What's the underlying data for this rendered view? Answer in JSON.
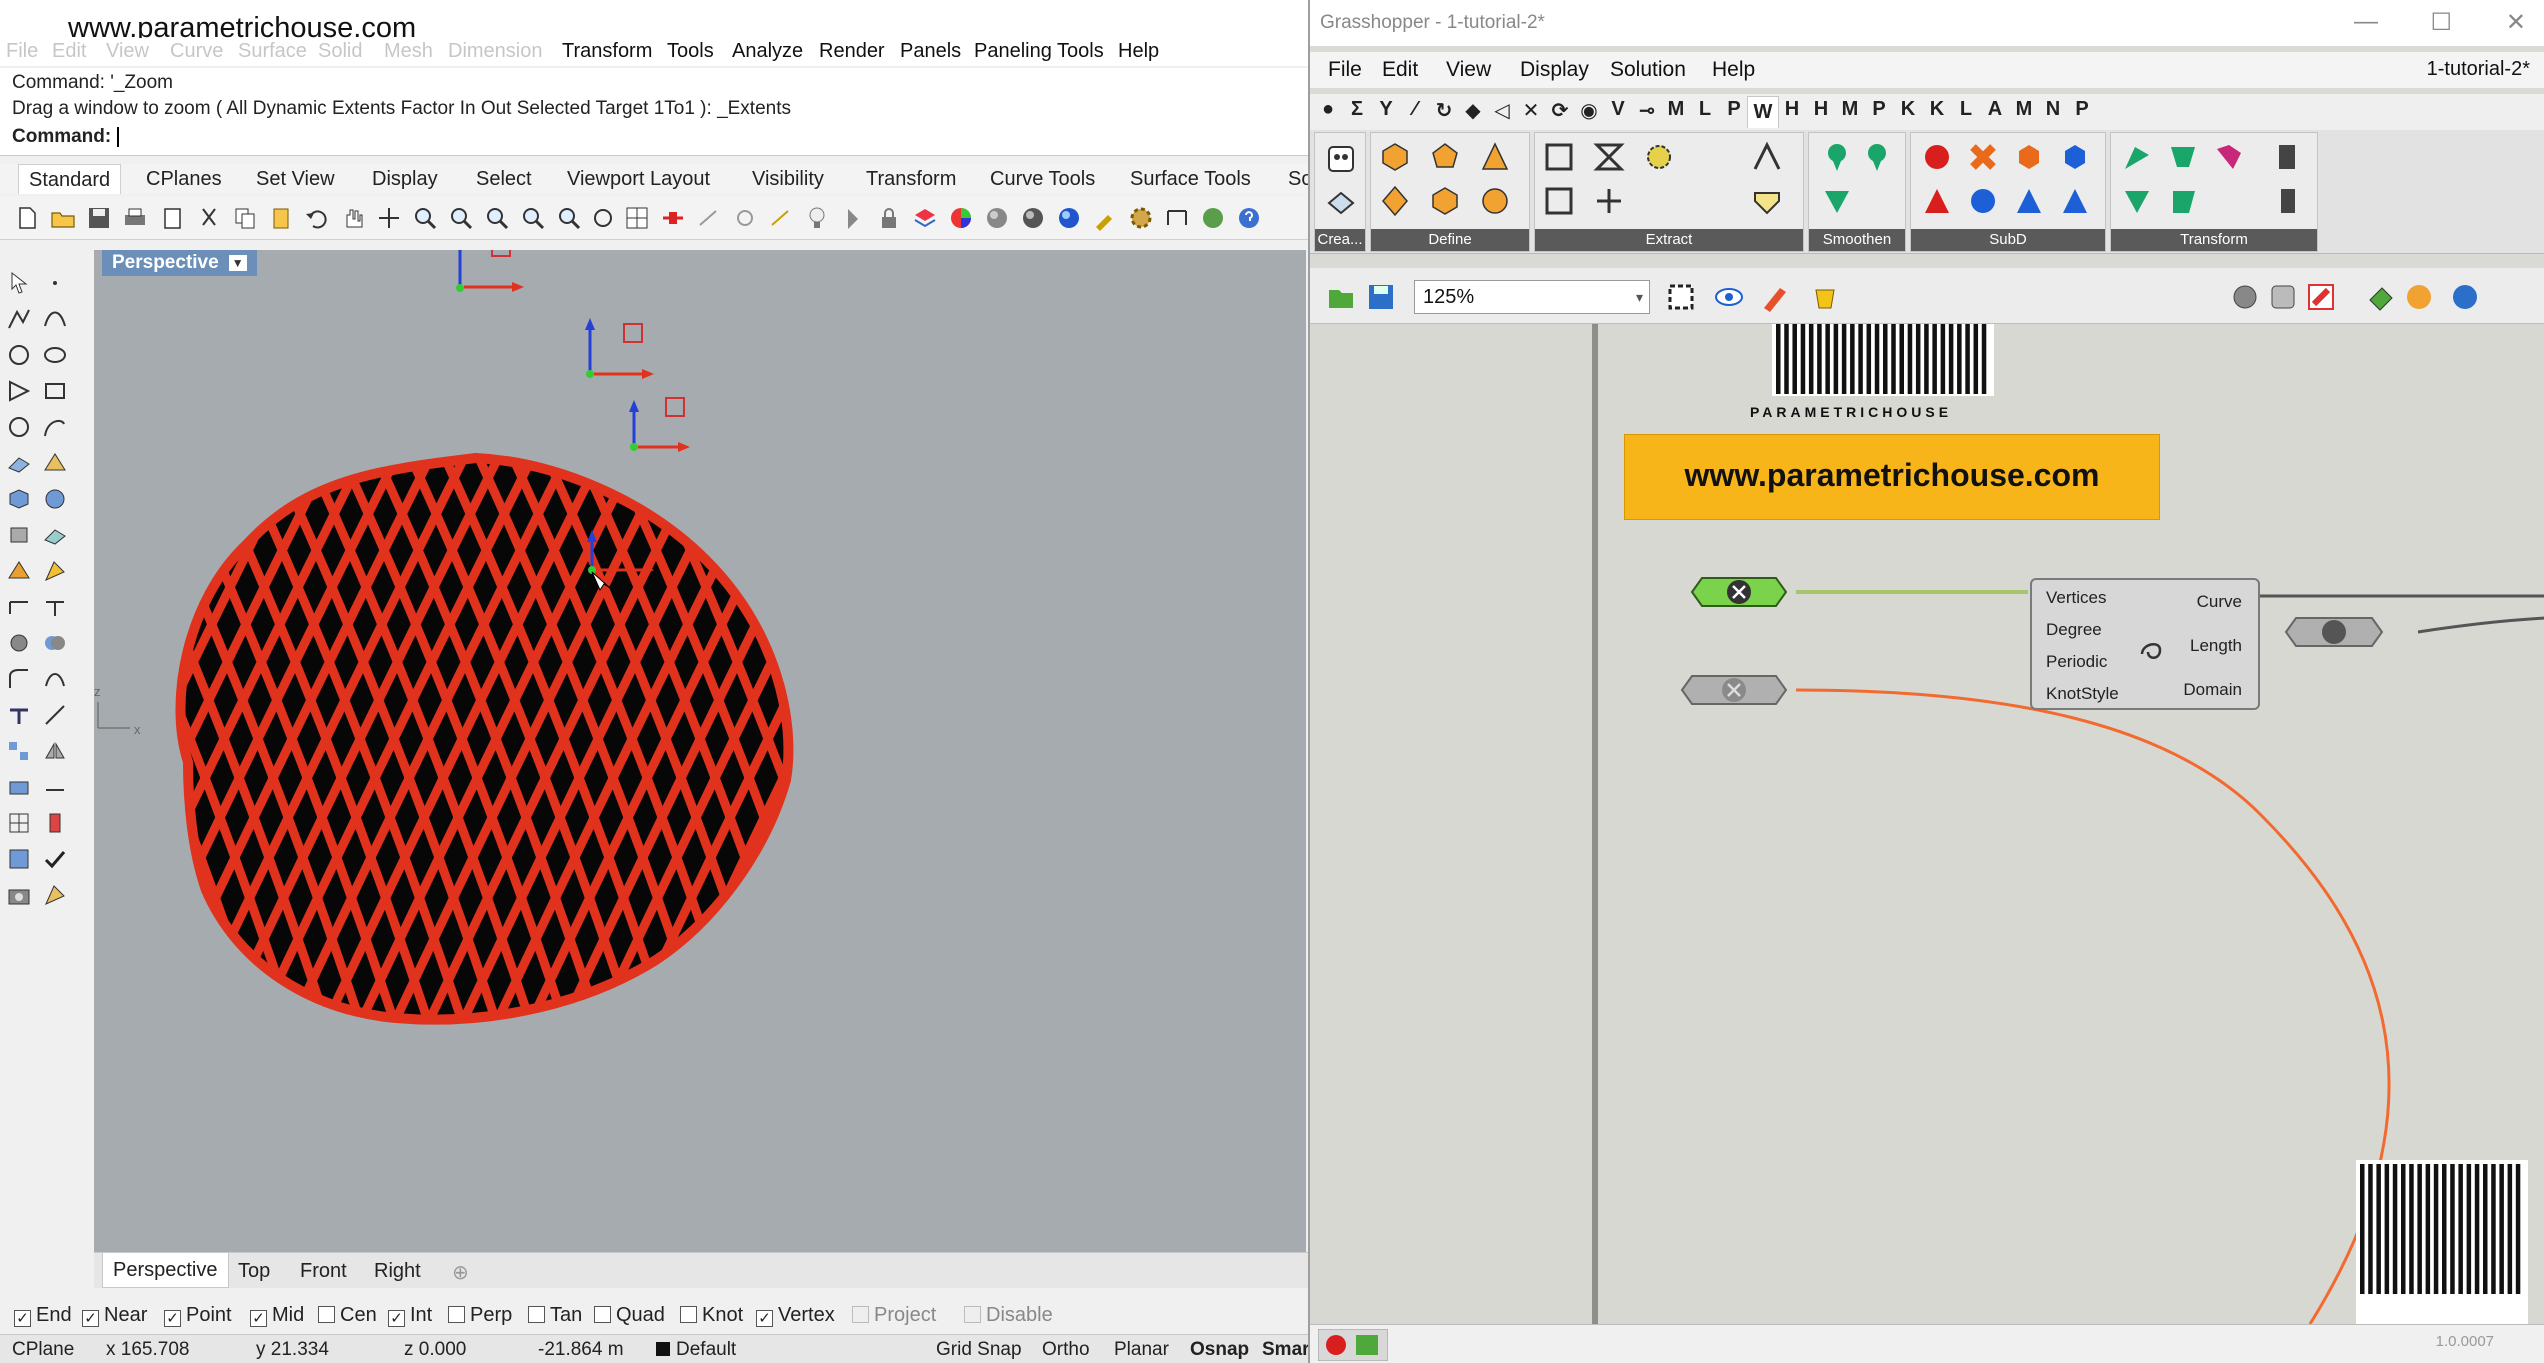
{
  "rhino": {
    "site_banner": "www.parametrichouse.com",
    "menu_items": [
      "Transform",
      "Tools",
      "Analyze",
      "Render",
      "Panels",
      "Paneling Tools",
      "Help"
    ],
    "ghost_menu_items": [
      "File",
      "Edit",
      "View",
      "Curve",
      "Surface",
      "Solid",
      "Mesh",
      "Dimension"
    ],
    "command_history": [
      "Command: '_Zoom",
      "Drag a window to zoom ( All  Dynamic  Extents  Factor  In  Out  Selected  Target  1To1 ): _Extents"
    ],
    "command_prompt": "Command:",
    "tabs": [
      "Standard",
      "CPlanes",
      "Set View",
      "Display",
      "Select",
      "Viewport Layout",
      "Visibility",
      "Transform",
      "Curve Tools",
      "Surface Tools",
      "So"
    ],
    "active_tab": "Standard",
    "viewport_title": "Perspective",
    "viewport_title_arrow": "▼",
    "axis_labels": {
      "z": "z",
      "x": "x"
    },
    "view_tabs": [
      "Perspective",
      "Top",
      "Front",
      "Right"
    ],
    "view_tab_add": "⊕",
    "osnaps": [
      {
        "label": "End",
        "checked": true
      },
      {
        "label": "Near",
        "checked": true
      },
      {
        "label": "Point",
        "checked": true
      },
      {
        "label": "Mid",
        "checked": true
      },
      {
        "label": "Cen",
        "checked": false
      },
      {
        "label": "Int",
        "checked": true
      },
      {
        "label": "Perp",
        "checked": false
      },
      {
        "label": "Tan",
        "checked": false
      },
      {
        "label": "Quad",
        "checked": false
      },
      {
        "label": "Knot",
        "checked": false
      },
      {
        "label": "Vertex",
        "checked": true
      },
      {
        "label": "Project",
        "checked": false,
        "disabled": true
      },
      {
        "label": "Disable",
        "checked": false,
        "disabled": true
      }
    ],
    "status": {
      "cplane": "CPlane",
      "x": "x 165.708",
      "y": "y 21.334",
      "z": "z 0.000",
      "distance": "-21.864 m",
      "layer": "Default",
      "grid_snap": "Grid Snap",
      "ortho": "Ortho",
      "planar": "Planar",
      "osnap": "Osnap",
      "smart": "Smar"
    },
    "mesh_color": "#e0321c"
  },
  "gh": {
    "title": "Grasshopper - 1-tutorial-2*",
    "window_controls": [
      "—",
      "☐",
      "✕"
    ],
    "menu_items": [
      "File",
      "Edit",
      "View",
      "Display",
      "Solution",
      "Help"
    ],
    "doc_name": "1-tutorial-2*",
    "categories": [
      "●",
      "Σ",
      "Y",
      "⁄",
      "↻",
      "◆",
      "◁",
      "✕",
      "⟳",
      "◉",
      "V",
      "⊸",
      "M",
      "L",
      "P",
      "W",
      "H",
      "H",
      "M",
      "P",
      "K",
      "K",
      "L",
      "A",
      "M",
      "N",
      "P"
    ],
    "active_category": "W",
    "ribbon_groups": [
      "Crea...",
      "Define",
      "Extract",
      "Smoothen",
      "SubD",
      "Transform"
    ],
    "zoom": "125%",
    "zoom_dropdown": "▾",
    "banner": "www.parametrichouse.com",
    "logo_text": "PARAMETRICHOUSE",
    "component": {
      "inputs": [
        "Vertices",
        "Degree",
        "Periodic",
        "KnotStyle"
      ],
      "outputs": [
        "Curve",
        "Length",
        "Domain"
      ]
    },
    "bottom_dash": "...",
    "version": "1.0.0007",
    "wire_color": "#f26a30"
  }
}
